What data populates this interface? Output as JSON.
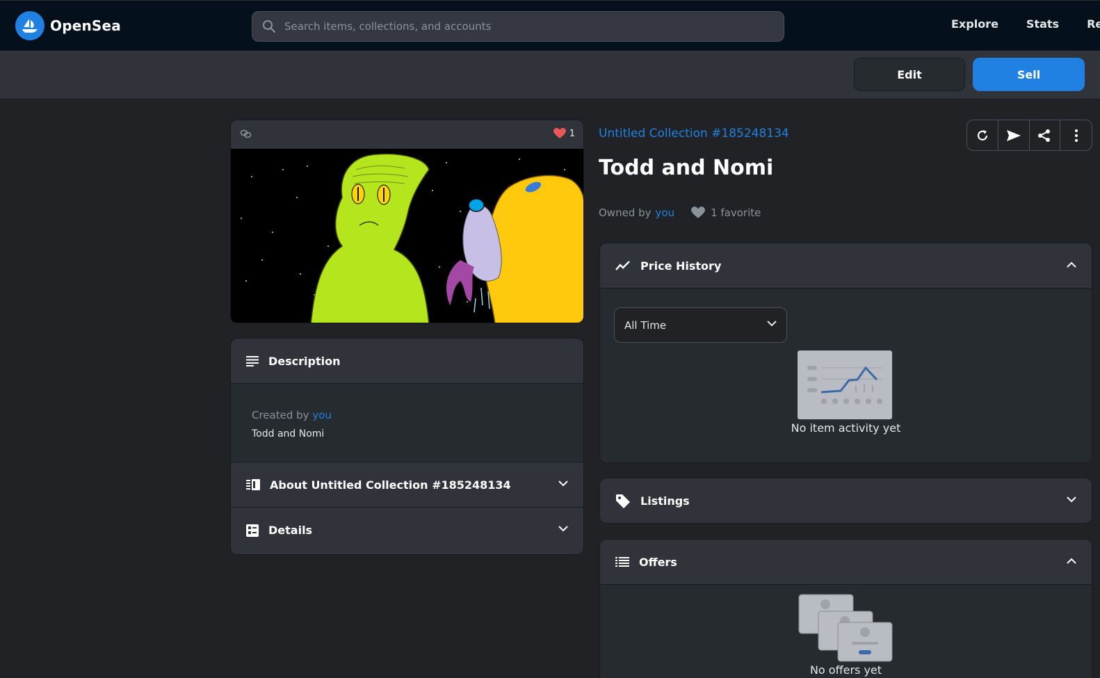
{
  "brand": {
    "name": "OpenSea",
    "color": "#2081e2"
  },
  "search": {
    "placeholder": "Search items, collections, and accounts"
  },
  "nav": {
    "explore": "Explore",
    "stats": "Stats",
    "resources": "Resc"
  },
  "actions": {
    "edit": "Edit",
    "sell": "Sell"
  },
  "item": {
    "collection": "Untitled Collection #185248134",
    "title": "Todd and Nomi",
    "owned_prefix": "Owned by",
    "owner": "you",
    "favorites_label": "1 favorite",
    "favorite_count": "1"
  },
  "description": {
    "heading": "Description",
    "created_prefix": "Created by",
    "creator": "you",
    "text": "Todd and Nomi"
  },
  "about": {
    "heading": "About Untitled Collection #185248134"
  },
  "details": {
    "heading": "Details"
  },
  "price_history": {
    "heading": "Price History",
    "range": "All Time",
    "empty": "No item activity yet"
  },
  "listings": {
    "heading": "Listings"
  },
  "offers": {
    "heading": "Offers",
    "empty": "No offers yet"
  },
  "icons": {
    "refresh": "refresh-icon",
    "transfer": "send-icon",
    "share": "share-icon",
    "more": "more-vertical-icon"
  }
}
